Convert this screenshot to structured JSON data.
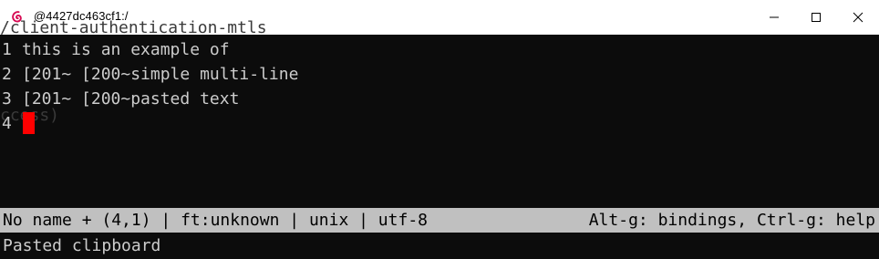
{
  "window": {
    "title": "@4427dc463cf1:/",
    "app_icon": "debian-swirl-icon",
    "controls": [
      "minimize-icon",
      "maximize-icon",
      "close-icon"
    ],
    "accent_color": "#d70a53"
  },
  "terminal": {
    "background": "#0c0c0c",
    "ghost_lines": [
      "/client-authentication-mtls",
      "ccess)"
    ],
    "lines": [
      {
        "number": "1",
        "text": "this is an example of"
      },
      {
        "number": "2",
        "text": "[201~ [200~simple multi-line"
      },
      {
        "number": "3",
        "text": "[201~ [200~pasted text"
      },
      {
        "number": "4",
        "text": ""
      }
    ],
    "cursor_color": "#ff0000"
  },
  "statusbar": {
    "left": "No name + (4,1) | ft:unknown | unix | utf-8",
    "right": "Alt-g: bindings, Ctrl-g: help"
  },
  "message": "Pasted clipboard"
}
